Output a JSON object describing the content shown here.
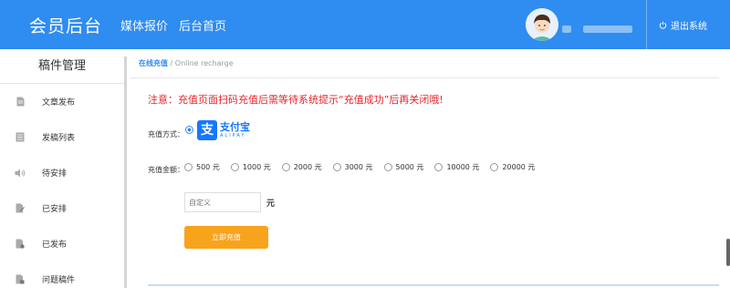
{
  "header": {
    "brand": "会员后台",
    "nav": [
      "媒体报价",
      "后台首页"
    ],
    "logout_label": "退出系统",
    "color": "#2f8cf0"
  },
  "sidebar": {
    "title": "稿件管理",
    "items": [
      {
        "label": "文章发布",
        "icon": "document-icon"
      },
      {
        "label": "发稿列表",
        "icon": "list-icon"
      },
      {
        "label": "待安排",
        "icon": "speaker-icon"
      },
      {
        "label": "已安排",
        "icon": "file-edit-icon"
      },
      {
        "label": "已发布",
        "icon": "file-check-icon"
      },
      {
        "label": "问题稿件",
        "icon": "file-warning-icon"
      }
    ]
  },
  "breadcrumb": {
    "current": "在线充值",
    "separator": " / ",
    "subtitle": "Online recharge"
  },
  "notice": "注意：充值页面扫码充值后需等待系统提示“充值成功”后再关闭哦!",
  "payment": {
    "label": "充值方式：",
    "method_cn": "支付宝",
    "method_en": "ALIPAY"
  },
  "amount": {
    "label": "充值金额：",
    "options": [
      "500 元",
      "1000 元",
      "2000 元",
      "3000 元",
      "5000 元",
      "10000 元",
      "20000 元"
    ],
    "custom_placeholder": "自定义",
    "unit": "元"
  },
  "submit_label": "立即充值",
  "colors": {
    "accent": "#2f8cf0",
    "button": "#f8a31c",
    "notice": "#e5242b"
  }
}
